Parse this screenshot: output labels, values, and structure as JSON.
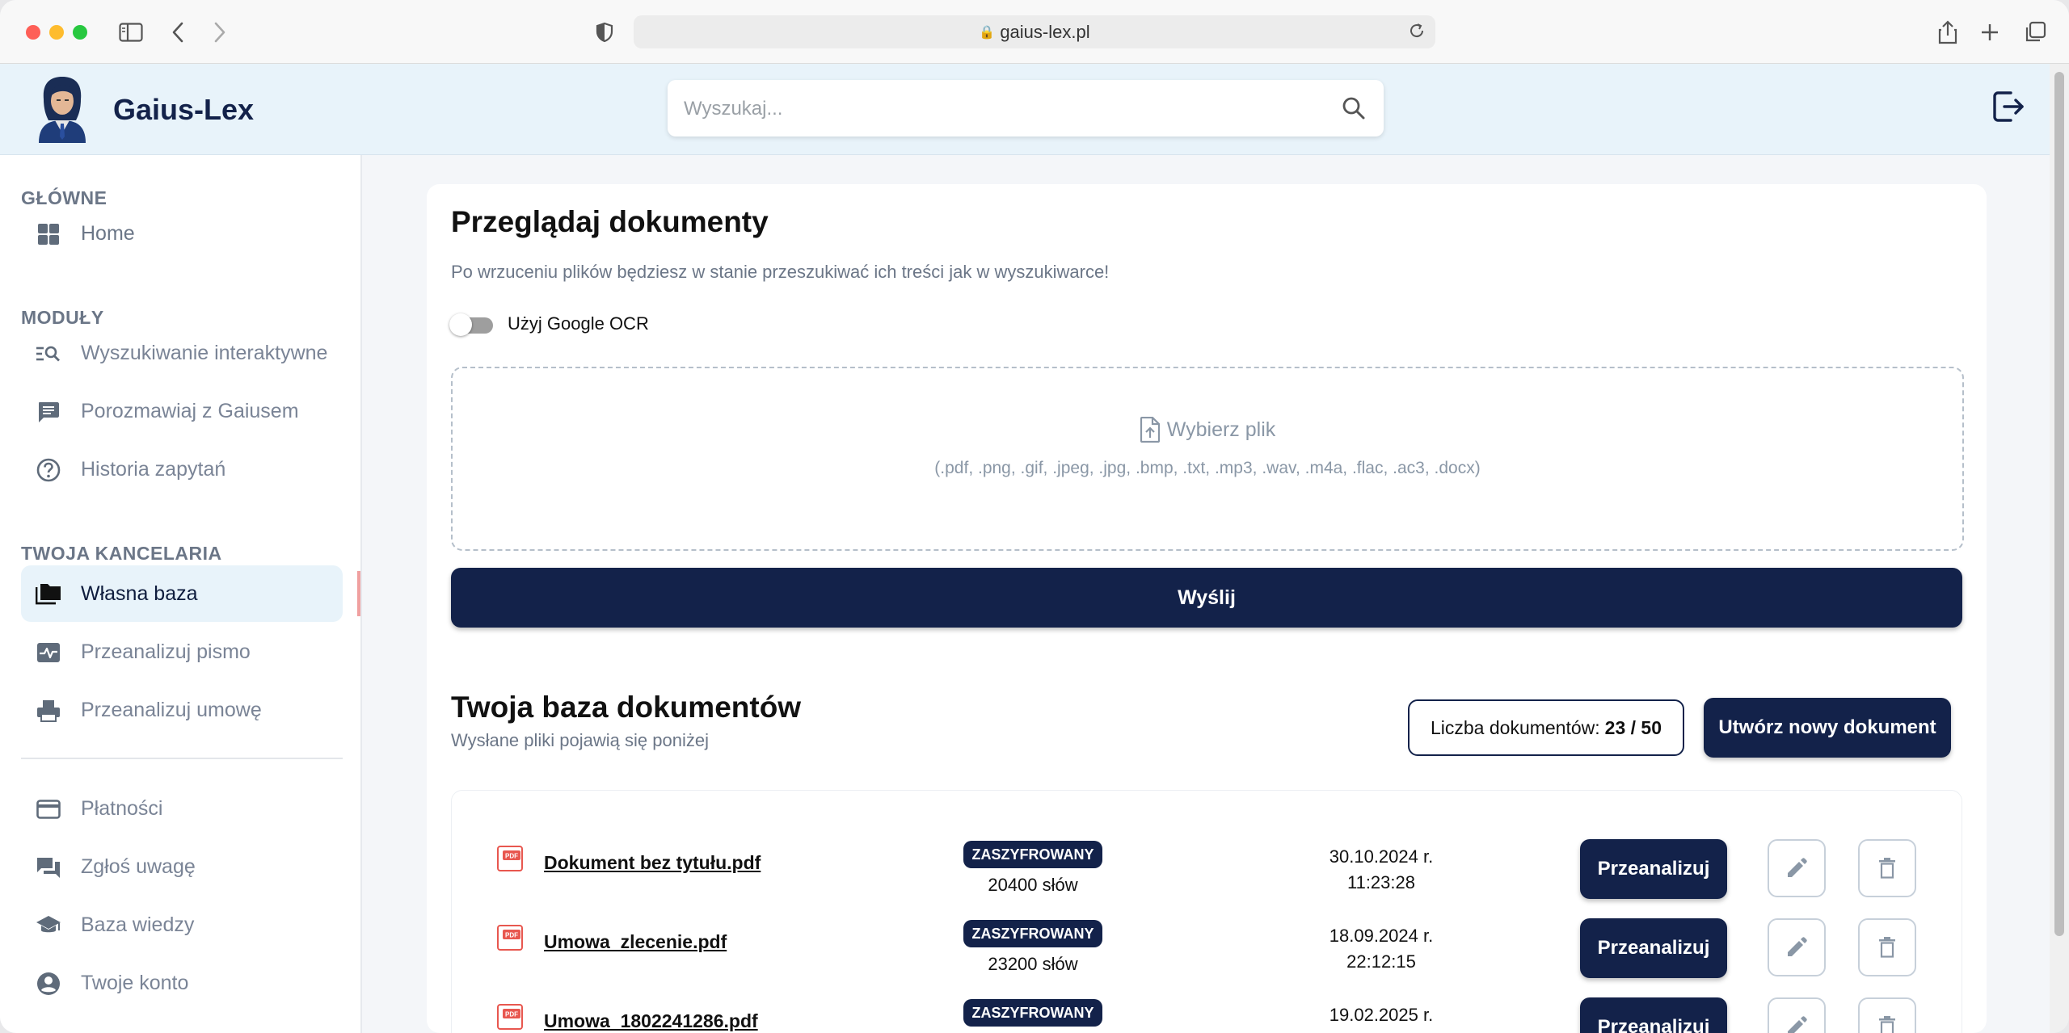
{
  "browser": {
    "url": "gaius-lex.pl"
  },
  "app": {
    "name": "Gaius-Lex",
    "search_placeholder": "Wyszukaj..."
  },
  "sidebar": {
    "sections": [
      {
        "title": "GŁÓWNE"
      },
      {
        "title": "MODUŁY"
      },
      {
        "title": "TWOJA KANCELARIA"
      }
    ],
    "items": [
      {
        "label": "Home",
        "icon": "dashboard-icon"
      },
      {
        "label": "Wyszukiwanie interaktywne",
        "icon": "search-list-icon"
      },
      {
        "label": "Porozmawiaj z Gaiusem",
        "icon": "chat-icon"
      },
      {
        "label": "Historia zapytań",
        "icon": "help-circle-icon"
      },
      {
        "label": "Własna baza",
        "icon": "folder-icon",
        "active": true
      },
      {
        "label": "Przeanalizuj pismo",
        "icon": "pulse-icon"
      },
      {
        "label": "Przeanalizuj umowę",
        "icon": "printer-icon"
      },
      {
        "label": "Płatności",
        "icon": "credit-card-icon"
      },
      {
        "label": "Zgłoś uwagę",
        "icon": "forum-icon"
      },
      {
        "label": "Baza wiedzy",
        "icon": "school-icon"
      },
      {
        "label": "Twoje konto",
        "icon": "account-icon"
      }
    ]
  },
  "upload": {
    "title": "Przeglądaj dokumenty",
    "subtitle": "Po wrzuceniu plików będziesz w stanie przeszukiwać ich treści jak w wyszukiwarce!",
    "ocr_label": "Użyj Google OCR",
    "ocr_enabled": false,
    "choose_file": "Wybierz plik",
    "file_types": "(.pdf, .png, .gif, .jpeg, .jpg, .bmp, .txt, .mp3, .wav, .m4a, .flac, .ac3, .docx)",
    "send_label": "Wyślij"
  },
  "documents": {
    "title": "Twoja baza dokumentów",
    "subtitle": "Wysłane pliki pojawią się poniżej",
    "count_label": "Liczba dokumentów:",
    "count_value": "23 / 50",
    "new_doc_label": "Utwórz nowy dokument",
    "rows": [
      {
        "name": "Dokument bez tytułu.pdf",
        "status": "ZASZYFROWANY",
        "words": "20400 słów",
        "date": "30.10.2024 r.",
        "time": "11:23:28",
        "action": "Przeanalizuj"
      },
      {
        "name": "Umowa_zlecenie.pdf",
        "status": "ZASZYFROWANY",
        "words": "23200 słów",
        "date": "18.09.2024 r.",
        "time": "22:12:15",
        "action": "Przeanalizuj"
      },
      {
        "name": "Umowa_1802241286.pdf",
        "status": "ZASZYFROWANY",
        "words": "",
        "date": "19.02.2025 r.",
        "time": "",
        "action": "Przeanalizuj"
      }
    ]
  },
  "colors": {
    "primary": "#13224a",
    "header_bg": "#e8f3fa",
    "muted_text": "#6b7687"
  }
}
